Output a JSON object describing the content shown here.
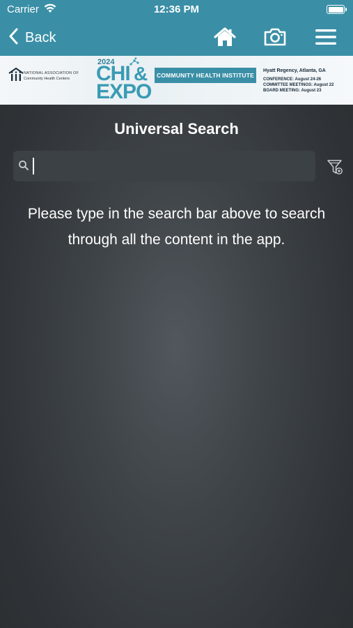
{
  "status_bar": {
    "carrier": "Carrier",
    "time": "12:36 PM",
    "wifi_icon": "wifi-icon",
    "battery_icon": "battery-icon"
  },
  "nav": {
    "back_label": "Back",
    "back_icon": "chevron-left-icon",
    "home_icon": "home-icon",
    "camera_icon": "camera-icon",
    "menu_icon": "hamburger-menu-icon",
    "bar_color": "#3a8fa6"
  },
  "banner": {
    "org_line1": "NATIONAL ASSOCIATION OF",
    "org_line2": "Community Health Centers",
    "year": "2024",
    "chi": "CHI",
    "amp": "&",
    "expo": "EXPO",
    "institute": "COMMUNITY HEALTH INSTITUTE",
    "venue": "Hyatt Regency, Atlanta, GA",
    "conference": "CONFERENCE: August 24-26",
    "committee": "COMMITTEE MEETINGS: August 22",
    "board": "BOARD MEETING: August 23"
  },
  "page": {
    "title": "Universal Search"
  },
  "search": {
    "value": "",
    "placeholder": "",
    "search_icon": "magnifier-icon",
    "filter_icon": "filter-icon"
  },
  "helper": {
    "text": "Please type in the search bar above to search through all the content in the app."
  }
}
